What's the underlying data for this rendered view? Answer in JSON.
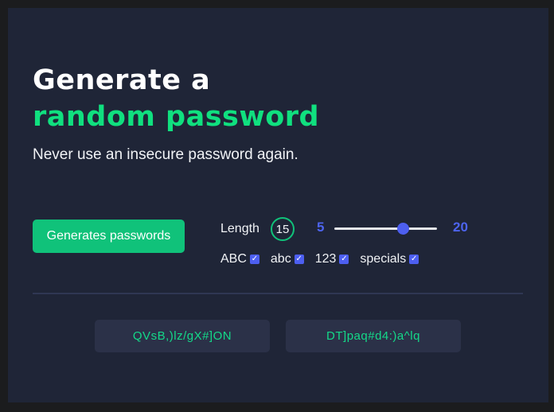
{
  "header": {
    "title_line1": "Generate a",
    "title_line2": "random password",
    "subtitle": "Never use an insecure password again."
  },
  "generator": {
    "button_label": "Generates passwords",
    "length_label": "Length",
    "length_value": "15",
    "min_label": "5",
    "max_label": "20",
    "slider": {
      "min": 5,
      "max": 20,
      "value": 15
    },
    "options": [
      {
        "label": "ABC",
        "checked": true
      },
      {
        "label": "abc",
        "checked": true
      },
      {
        "label": "123",
        "checked": true
      },
      {
        "label": "specials",
        "checked": true
      }
    ]
  },
  "passwords": [
    "QVsB,)lz/gX#]ON",
    "DT]paq#d4:)a^lq"
  ],
  "colors": {
    "background": "#1f2537",
    "accent_green": "#10e07f",
    "button_green": "#10c27a",
    "accent_blue": "#4d5ff0",
    "password_box": "#2b3148"
  },
  "icons": {
    "checkbox": "checkmark-icon"
  }
}
